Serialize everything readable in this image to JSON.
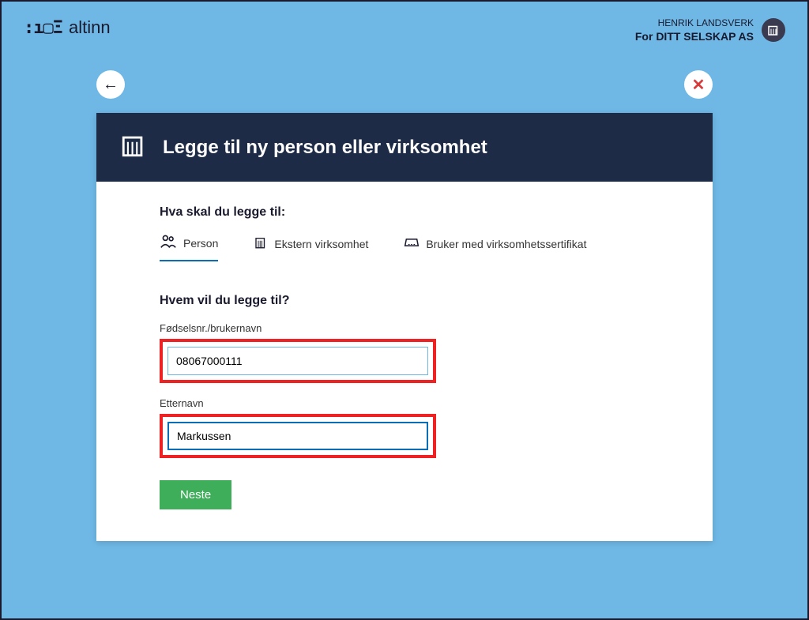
{
  "header": {
    "logo_text": "altinn",
    "user_name": "HENRIK LANDSVERK",
    "for_prefix": "For",
    "org_name": "DITT SELSKAP AS"
  },
  "modal": {
    "title": "Legge til ny person eller virksomhet",
    "section1_label": "Hva skal du legge til:",
    "tabs": {
      "person": "Person",
      "ekstern": "Ekstern virksomhet",
      "bruker": "Bruker med virksomhetssertifikat"
    },
    "section2_label": "Hvem vil du legge til?",
    "field1_label": "Fødselsnr./brukernavn",
    "field1_value": "08067000111",
    "field2_label": "Etternavn",
    "field2_value": "Markussen",
    "next_button": "Neste"
  }
}
